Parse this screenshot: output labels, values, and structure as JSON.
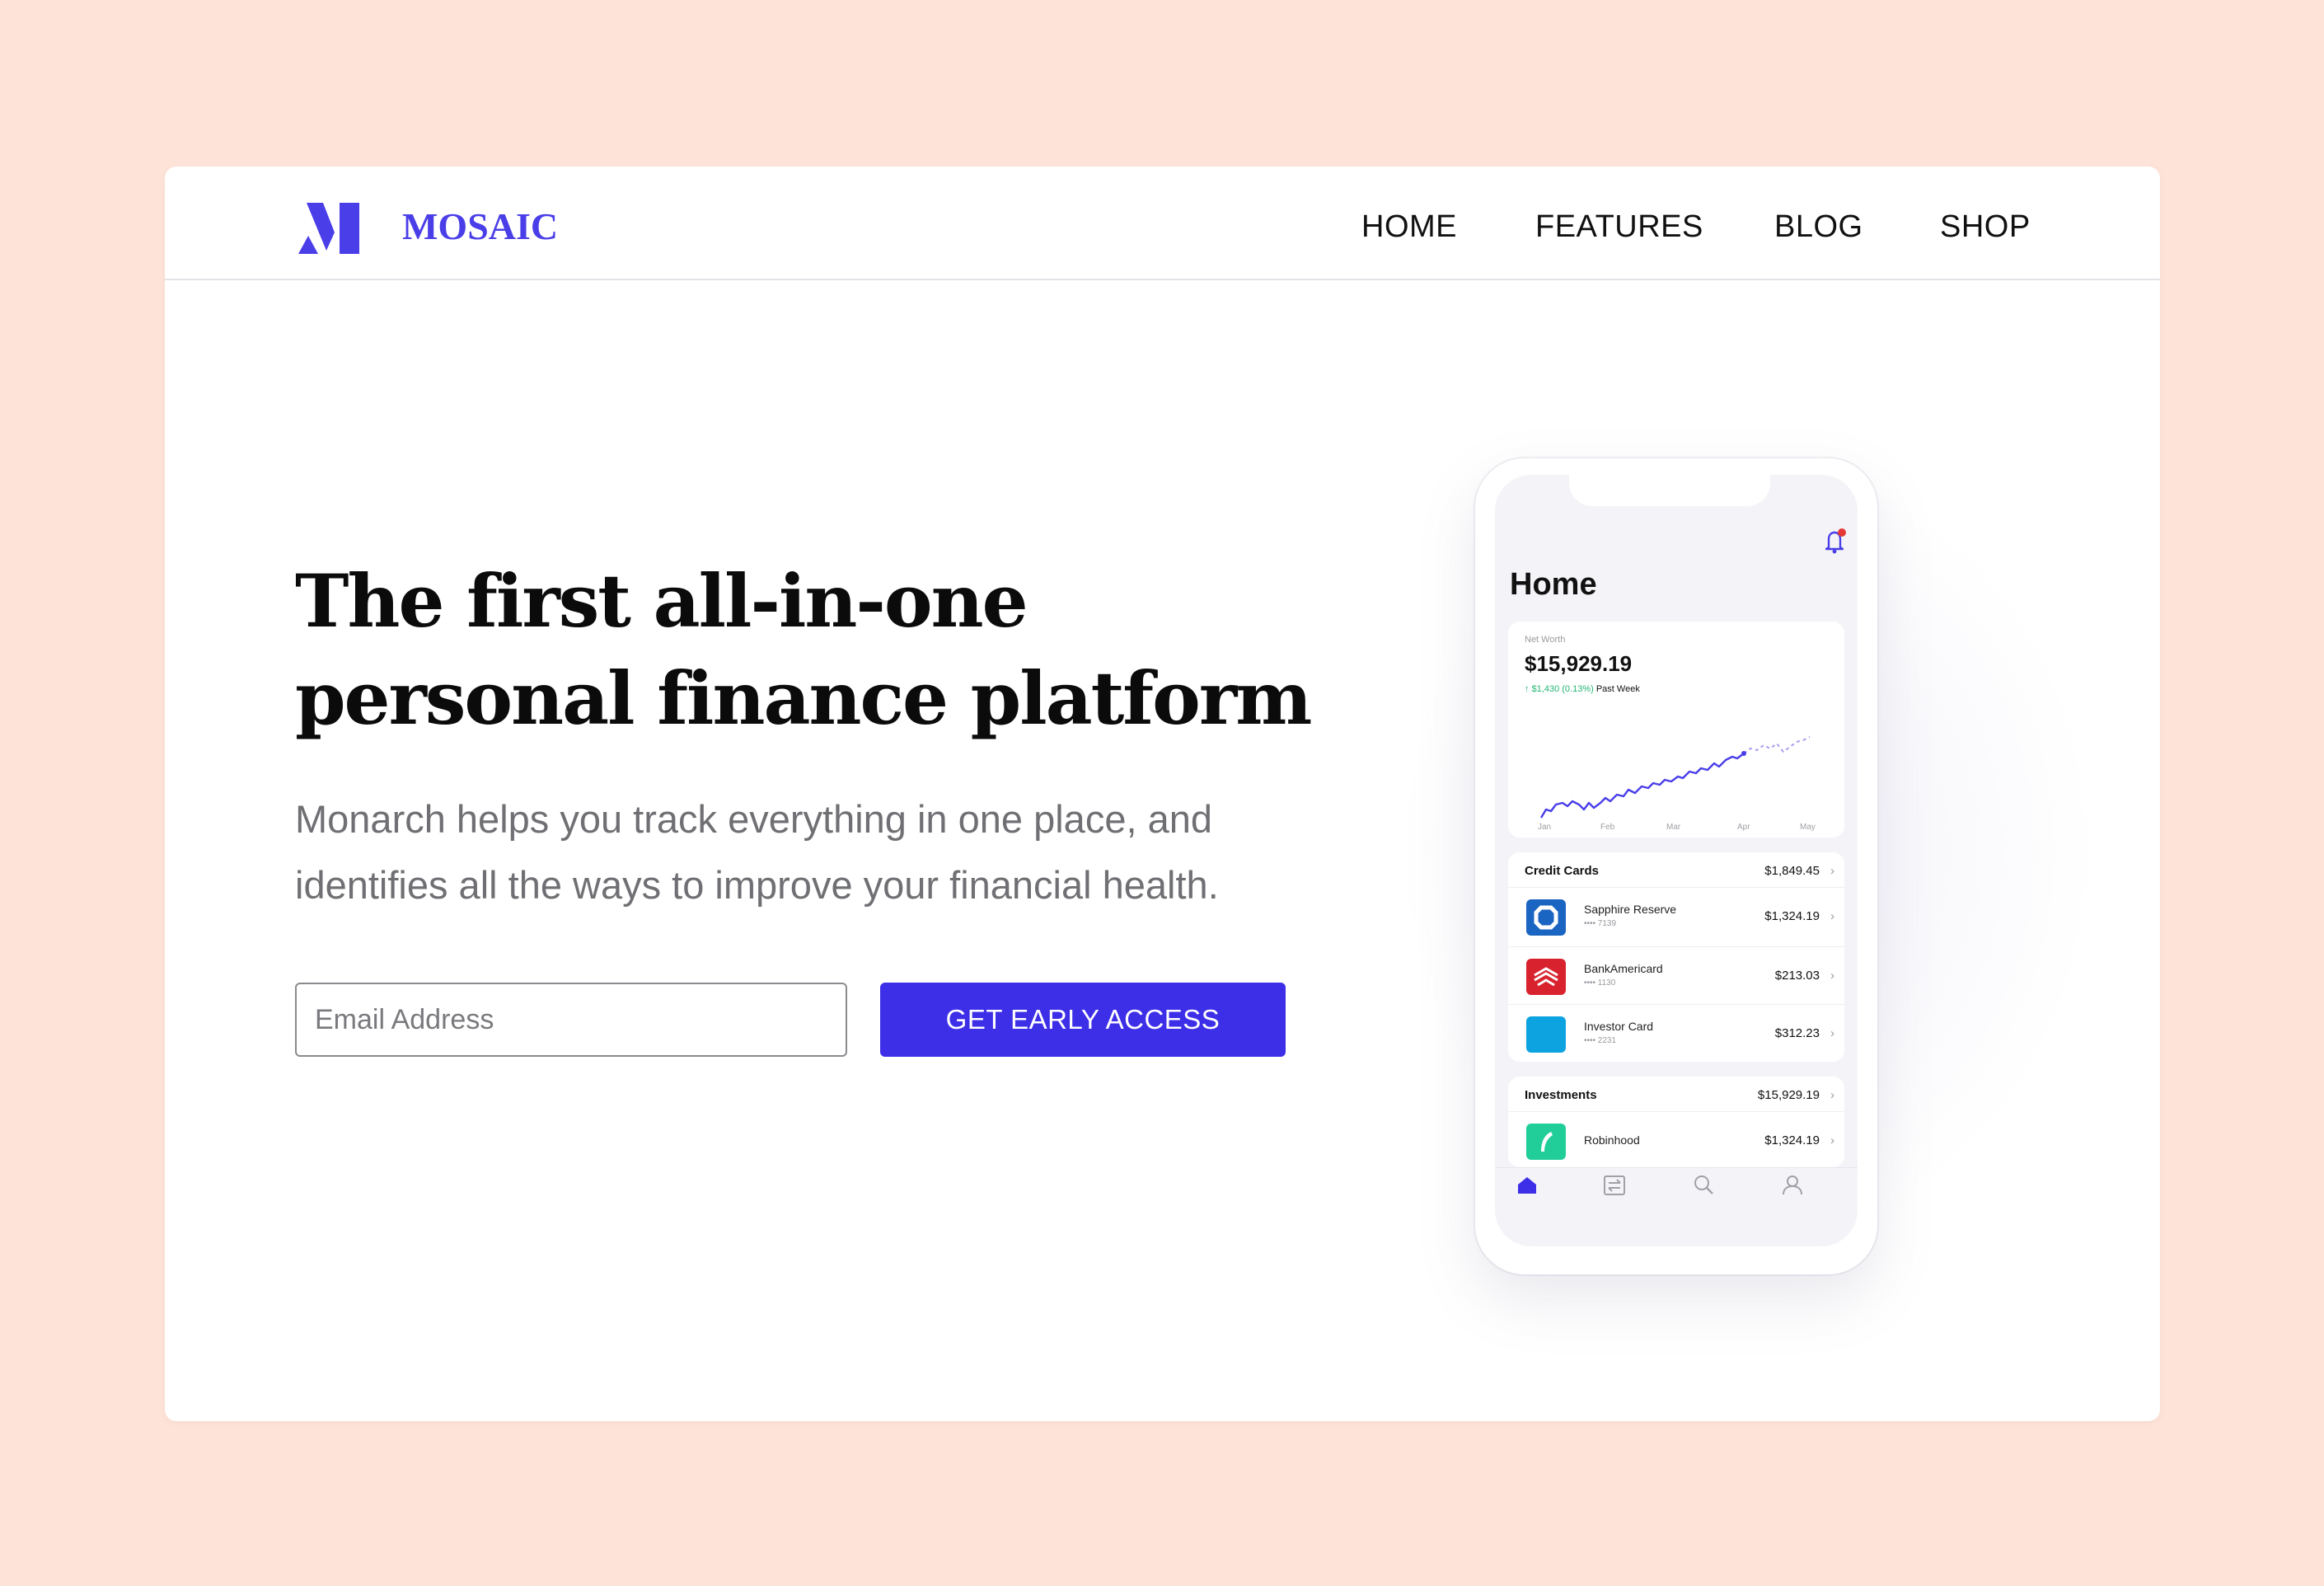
{
  "brand": {
    "name": "MOSAIC",
    "color": "#4a3ee8"
  },
  "nav": {
    "items": [
      "HOME",
      "FEATURES",
      "BLOG",
      "SHOP"
    ]
  },
  "hero": {
    "headline_line1": "The first all-in-one",
    "headline_line2": "personal finance platform",
    "subtext_line1": "Monarch helps you track everything in one place, and",
    "subtext_line2": "identifies all the ways to improve your financial health.",
    "email_placeholder": "Email Address",
    "cta_label": "GET EARLY ACCESS",
    "cta_color": "#3d2ee8"
  },
  "phone": {
    "screen_title": "Home",
    "net_worth": {
      "label": "Net Worth",
      "value": "$15,929.19",
      "change": "$1,430 (0.13%)",
      "period": "Past Week",
      "months": [
        "Jan",
        "Feb",
        "Mar",
        "Apr",
        "May"
      ]
    },
    "credit_cards": {
      "title": "Credit Cards",
      "total": "$1,849.45",
      "accounts": [
        {
          "name": "Sapphire Reserve",
          "mask": "•••• 7139",
          "amount": "$1,324.19",
          "color": "#1a64c2",
          "icon": "chase-icon"
        },
        {
          "name": "BankAmericard",
          "mask": "•••• 1130",
          "amount": "$213.03",
          "color": "#d8232f",
          "icon": "bofa-icon"
        },
        {
          "name": "Investor Card",
          "mask": "•••• 2231",
          "amount": "$312.23",
          "color": "#0da3e0",
          "icon": "schwab-icon"
        }
      ]
    },
    "investments": {
      "title": "Investments",
      "total": "$15,929.19",
      "accounts": [
        {
          "name": "Robinhood",
          "amount": "$1,324.19",
          "color": "#21ce99",
          "icon": "robinhood-icon"
        }
      ]
    },
    "tabs": [
      "home-tab-icon",
      "transactions-tab-icon",
      "search-tab-icon",
      "profile-tab-icon"
    ]
  }
}
